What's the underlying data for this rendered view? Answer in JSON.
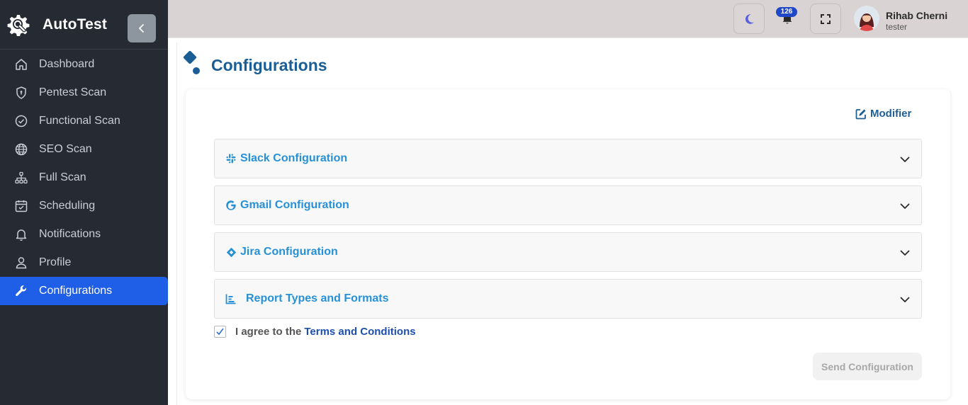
{
  "brand": {
    "title": "AutoTest"
  },
  "sidebar": {
    "items": [
      {
        "label": "Dashboard",
        "icon": "home-icon"
      },
      {
        "label": "Pentest Scan",
        "icon": "shield-icon"
      },
      {
        "label": "Functional Scan",
        "icon": "check-circle-icon"
      },
      {
        "label": "SEO Scan",
        "icon": "globe-icon"
      },
      {
        "label": "Full Scan",
        "icon": "sitemap-icon"
      },
      {
        "label": "Scheduling",
        "icon": "calendar-check-icon"
      },
      {
        "label": "Notifications",
        "icon": "bell-icon"
      },
      {
        "label": "Profile",
        "icon": "user-icon"
      },
      {
        "label": "Configurations",
        "icon": "wrench-icon",
        "active": true
      }
    ]
  },
  "topbar": {
    "notification_count": "126",
    "user": {
      "name": "Rihab Cherni",
      "role": "tester"
    }
  },
  "main": {
    "title": "Configurations",
    "edit_label": "Modifier",
    "sections": [
      {
        "label": "Slack Configuration",
        "icon": "slack-icon"
      },
      {
        "label": "Gmail Configuration",
        "icon": "google-icon"
      },
      {
        "label": "Jira Configuration",
        "icon": "jira-icon"
      },
      {
        "label": "Report Types and Formats",
        "icon": "bar-chart-icon"
      }
    ],
    "agree_text": "I agree to the",
    "terms_link": "Terms and Conditions",
    "agree_checked": true,
    "send_label": "Send Configuration"
  },
  "colors": {
    "sidebar_bg": "#262a33",
    "active_item": "#1f5ee6",
    "topbar_bg": "#dad3d3",
    "title_blue": "#1b5d95",
    "section_blue": "#2791d8",
    "badge": "#1f47c8"
  }
}
